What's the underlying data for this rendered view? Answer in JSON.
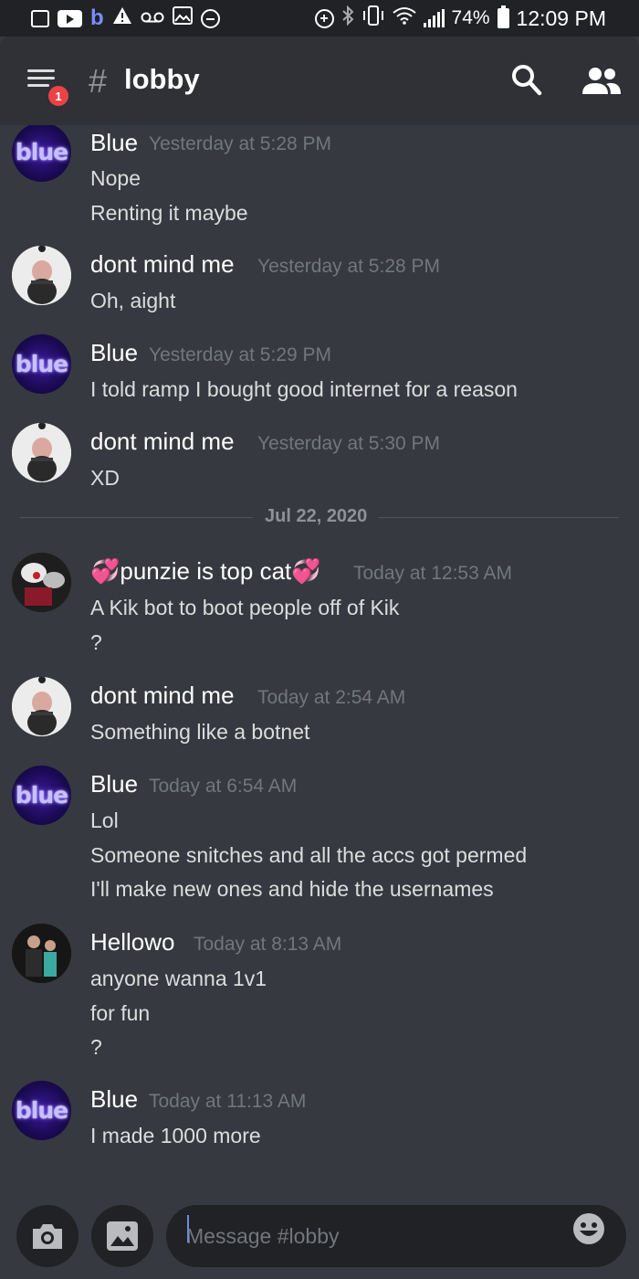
{
  "status_bar": {
    "app_letter": "b",
    "battery": "74%",
    "time": "12:09 PM"
  },
  "header": {
    "notification_count": "1",
    "hash": "#",
    "channel_name": "lobby"
  },
  "messages": [
    {
      "author": "Blue",
      "timestamp": "Yesterday at 5:28 PM",
      "lines": [
        "Nope",
        "Renting it maybe"
      ]
    },
    {
      "author": "dont mind me",
      "timestamp": "Yesterday at 5:28 PM",
      "lines": [
        "Oh, aight"
      ]
    },
    {
      "author": "Blue",
      "timestamp": "Yesterday at 5:29 PM",
      "lines": [
        "I told ramp I bought good internet for a reason"
      ]
    },
    {
      "author": "dont mind me",
      "timestamp": "Yesterday at 5:30 PM",
      "lines": [
        "XD"
      ]
    },
    {
      "author": "💞punzie is top cat💞",
      "timestamp": "Today at 12:53 AM",
      "lines": [
        "A Kik bot to boot people off of Kik",
        "?"
      ]
    },
    {
      "author": "dont mind me",
      "timestamp": "Today at 2:54 AM",
      "lines": [
        "Something like a botnet"
      ]
    },
    {
      "author": "Blue",
      "timestamp": "Today at 6:54 AM",
      "lines": [
        "Lol",
        "Someone snitches and all the accs got permed",
        "I'll make new ones and hide the usernames"
      ]
    },
    {
      "author": "Hellowo",
      "timestamp": "Today at 8:13 AM",
      "lines": [
        "anyone wanna 1v1",
        "for fun",
        "?"
      ]
    },
    {
      "author": "Blue",
      "timestamp": "Today at 11:13 AM",
      "lines": [
        "I made 1000 more"
      ]
    }
  ],
  "avatar_texts": {
    "blue": "blue"
  },
  "date_divider": "Jul 22, 2020",
  "composer": {
    "placeholder": "Message #lobby"
  },
  "colors": {
    "background": "#36393f",
    "header": "#2f3136",
    "input": "#202225",
    "badge": "#ed4245",
    "timestamp": "#72767d"
  }
}
